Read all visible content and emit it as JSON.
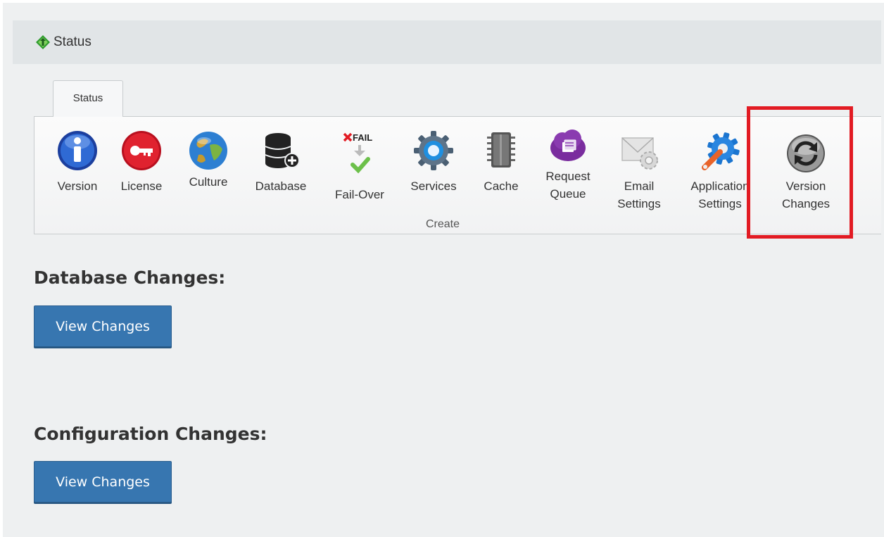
{
  "header": {
    "title": "Status"
  },
  "tabs": [
    {
      "label": "Status"
    }
  ],
  "ribbon": {
    "buttons": [
      {
        "label": "Version",
        "icon": "info-icon"
      },
      {
        "label": "License",
        "icon": "key-icon"
      },
      {
        "label": "Culture",
        "icon": "globe-icon"
      },
      {
        "label": "Database",
        "icon": "database-add-icon"
      },
      {
        "label": "Fail-Over",
        "icon": "fail-over-icon",
        "icon_text": "FAIL"
      },
      {
        "label": "Services",
        "icon": "services-gear-icon"
      },
      {
        "label": "Cache",
        "icon": "cache-chip-icon"
      },
      {
        "label": "Request\nQueue",
        "icon": "request-queue-cloud-icon"
      },
      {
        "label": "Email\nSettings",
        "icon": "email-settings-icon"
      },
      {
        "label": "Application\nSettings",
        "icon": "application-settings-icon"
      },
      {
        "label": "Version\nChanges",
        "icon": "refresh-icon"
      }
    ],
    "group_label": "Create"
  },
  "sections": {
    "database": {
      "title": "Database Changes:",
      "button_label": "View Changes"
    },
    "configuration": {
      "title": "Configuration Changes:",
      "button_label": "View Changes"
    }
  },
  "colors": {
    "highlight": "#e21b23",
    "button": "#3776b0"
  }
}
